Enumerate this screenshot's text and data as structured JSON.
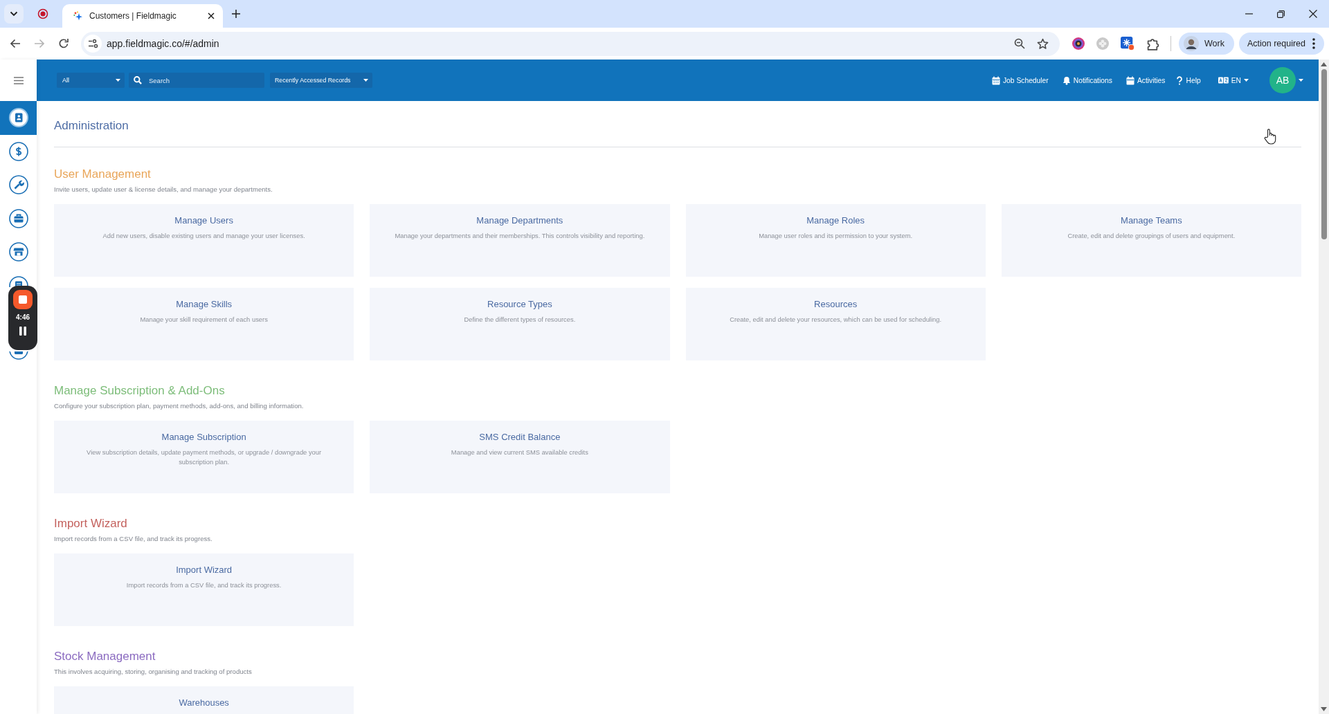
{
  "browser": {
    "tab": {
      "title": "Customers | Fieldmagic",
      "selected": true
    },
    "url": "app.fieldmagic.co/#/admin",
    "profile": "Work",
    "alert": "Action required"
  },
  "sidebar": {
    "items": [
      {
        "selected": true
      },
      {
        "selected": false
      },
      {
        "selected": false
      },
      {
        "selected": false
      },
      {
        "selected": false
      },
      {
        "selected": false
      },
      {
        "selected": false
      }
    ]
  },
  "header": {
    "filter": "All",
    "search": {
      "placeholder": "Search"
    },
    "recent": "Recently Accessed Records",
    "links": [
      {
        "label": "Job Scheduler"
      },
      {
        "label": "Notifications"
      },
      {
        "label": "Activities"
      },
      {
        "label": "Help"
      }
    ],
    "language": "EN",
    "avatar": "AB"
  },
  "page": {
    "title": "Administration",
    "sections": [
      {
        "heading": "User Management",
        "color": "#e9a65a",
        "description": "Invite users, update user & license details, and manage your departments.",
        "cards": [
          {
            "title": "Manage Users",
            "description": "Add new users, disable existing users and manage your user licenses."
          },
          {
            "title": "Manage Departments",
            "description": "Manage your departments and their memberships. This controls visibility and reporting."
          },
          {
            "title": "Manage Roles",
            "description": "Manage user roles and its permission to your system."
          },
          {
            "title": "Manage Teams",
            "description": "Create, edit and delete groupings of users and equipment."
          },
          {
            "title": "Manage Skills",
            "description": "Manage your skill requirement of each users"
          },
          {
            "title": "Resource Types",
            "description": "Define the different types of resources."
          },
          {
            "title": "Resources",
            "description": "Create, edit and delete your resources, which can be used for scheduling."
          }
        ]
      },
      {
        "heading": "Manage Subscription & Add-Ons",
        "color": "#7dbd7a",
        "description": "Configure your subscription plan, payment methods, add-ons, and billing information.",
        "cards": [
          {
            "title": "Manage Subscription",
            "description": "View subscription details, update payment methods, or upgrade / downgrade your subscription plan."
          },
          {
            "title": "SMS Credit Balance",
            "description": "Manage and view current SMS available credits"
          }
        ]
      },
      {
        "heading": "Import Wizard",
        "color": "#c4625e",
        "description": "Import records from a CSV file, and track its progress.",
        "cards": [
          {
            "title": "Import Wizard",
            "description": "Import records from a CSV file, and track its progress."
          }
        ]
      },
      {
        "heading": "Stock Management",
        "color": "#8b6bc0",
        "description": "This involves acquiring, storing, organising and tracking of products",
        "cards": [
          {
            "title": "Warehouses"
          }
        ]
      }
    ]
  },
  "recorder": {
    "time": "4:46"
  }
}
